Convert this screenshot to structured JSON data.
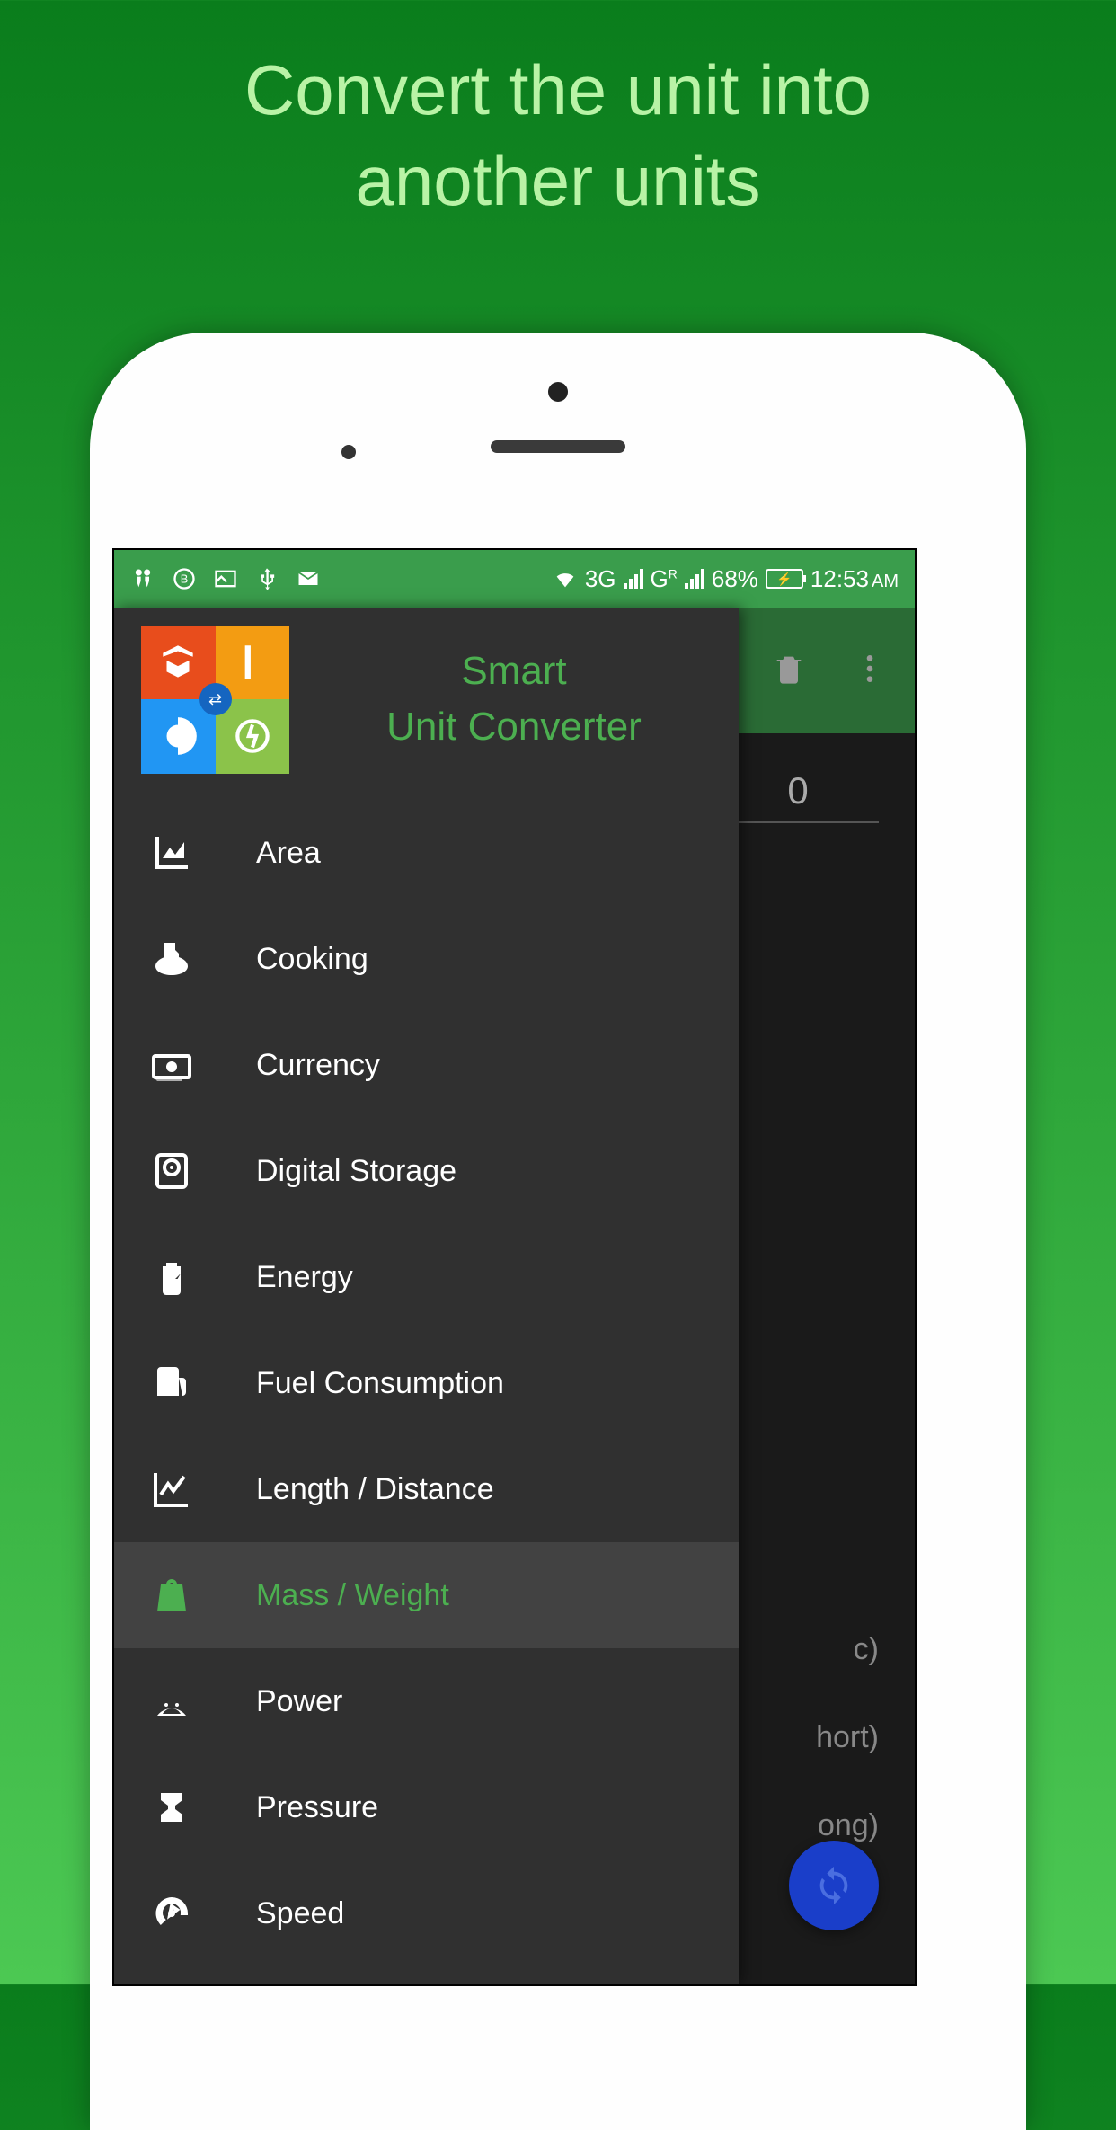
{
  "promo": {
    "title_line1": "Convert the unit into",
    "title_line2": "another units"
  },
  "status_bar": {
    "network": "3G",
    "network2": "G",
    "battery": "68%",
    "time": "12:53",
    "ampm": "AM"
  },
  "main": {
    "value": "0",
    "bg_items": [
      "c)",
      "hort)",
      "ong)"
    ]
  },
  "drawer": {
    "title_line1": "Smart",
    "title_line2": "Unit Converter",
    "items": [
      {
        "label": "Area",
        "icon": "chart-icon",
        "active": false
      },
      {
        "label": "Cooking",
        "icon": "cooking-icon",
        "active": false
      },
      {
        "label": "Currency",
        "icon": "currency-icon",
        "active": false
      },
      {
        "label": "Digital Storage",
        "icon": "disk-icon",
        "active": false
      },
      {
        "label": "Energy",
        "icon": "energy-icon",
        "active": false
      },
      {
        "label": "Fuel Consumption",
        "icon": "fuel-icon",
        "active": false
      },
      {
        "label": "Length / Distance",
        "icon": "length-icon",
        "active": false
      },
      {
        "label": "Mass / Weight",
        "icon": "weight-icon",
        "active": true
      },
      {
        "label": "Power",
        "icon": "power-icon",
        "active": false
      },
      {
        "label": "Pressure",
        "icon": "pressure-icon",
        "active": false
      },
      {
        "label": "Speed",
        "icon": "speed-icon",
        "active": false
      }
    ]
  }
}
